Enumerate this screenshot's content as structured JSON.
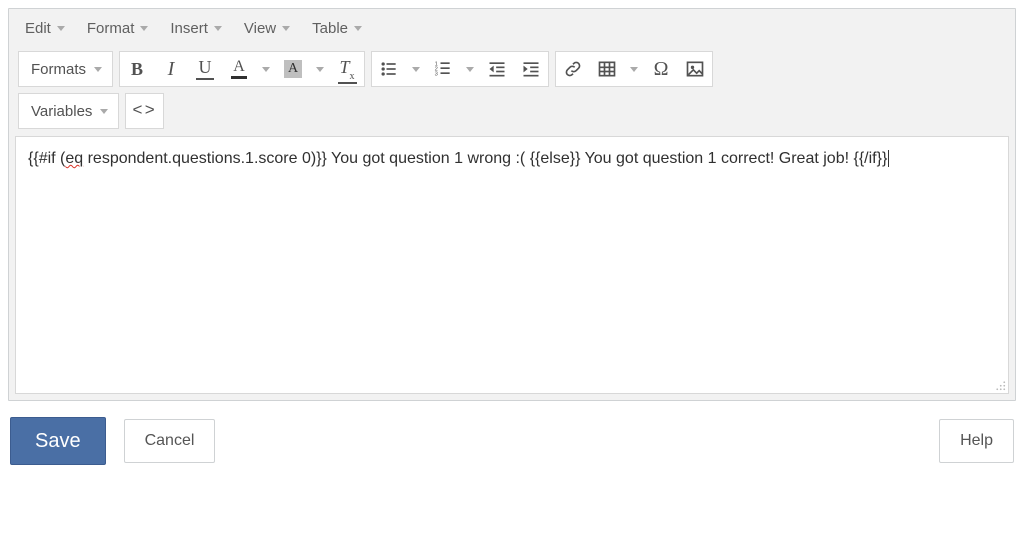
{
  "menubar": {
    "edit": "Edit",
    "format": "Format",
    "insert": "Insert",
    "view": "View",
    "table": "Table"
  },
  "toolbar": {
    "formats_label": "Formats",
    "variables_label": "Variables"
  },
  "content": {
    "spellerr_word": "eq",
    "text_pre": "{{#if (",
    "text_mid": " respondent.questions.1.score 0)}} You got question 1 wrong :( {{else}} You got question 1 correct! Great job! {{/if}}"
  },
  "footer": {
    "save": "Save",
    "cancel": "Cancel",
    "help": "Help"
  }
}
